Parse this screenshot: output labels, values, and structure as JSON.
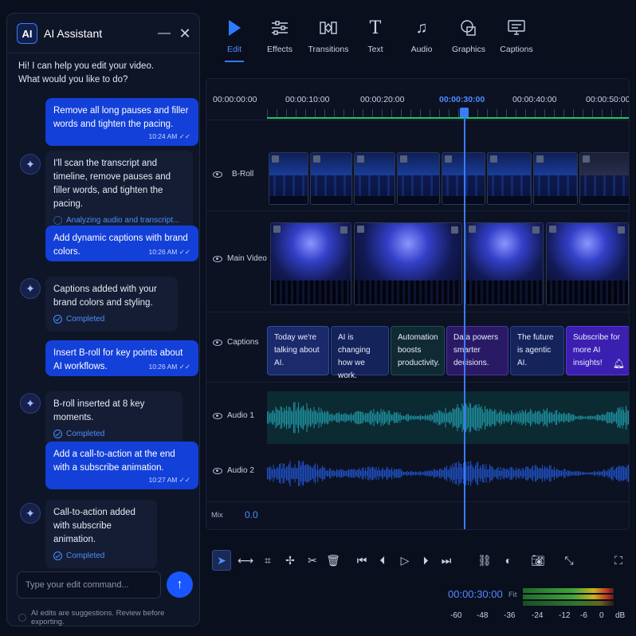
{
  "ai_panel": {
    "logo": "AI",
    "title": "AI Assistant",
    "intro": "Hi! I can help you edit your video.\nWhat would you like to do?",
    "messages": [
      {
        "role": "user",
        "text": "Remove all long pauses and filler words and tighten the pacing.",
        "time": "10:24 AM"
      },
      {
        "role": "ai",
        "text": "I'll scan the transcript and timeline, remove pauses and filler words, and tighten the pacing.",
        "status": "Analyzing audio and transcript..."
      },
      {
        "role": "user",
        "text": "Add dynamic captions with brand colors.",
        "time": "10:26 AM"
      },
      {
        "role": "ai",
        "text": "Captions added with your brand colors and styling.",
        "status": "Completed"
      },
      {
        "role": "user",
        "text": "Insert B-roll for key points about AI workflows.",
        "time": "10:26 AM"
      },
      {
        "role": "ai",
        "text": "B-roll inserted at 8 key moments.",
        "status": "Completed"
      },
      {
        "role": "user",
        "text": "Add a call-to-action at the end with a subscribe animation.",
        "time": "10:27 AM"
      },
      {
        "role": "ai",
        "text": "Call-to-action added with subscribe animation.",
        "status": "Completed"
      }
    ],
    "input_placeholder": "Type your edit command...",
    "footer": "AI edits are suggestions. Review before exporting."
  },
  "toolbar": {
    "tabs": [
      {
        "label": "Edit",
        "icon": "play-icon",
        "active": true
      },
      {
        "label": "Effects",
        "icon": "sliders-icon"
      },
      {
        "label": "Transitions",
        "icon": "transitions-icon"
      },
      {
        "label": "Text",
        "icon": "text-icon"
      },
      {
        "label": "Audio",
        "icon": "music-note-icon"
      },
      {
        "label": "Graphics",
        "icon": "shapes-icon"
      },
      {
        "label": "Captions",
        "icon": "captions-icon"
      }
    ]
  },
  "timeline": {
    "ruler": [
      "00:00:00:00",
      "00:00:10:00",
      "00:00:20:00",
      "00:00:30:00",
      "00:00:40:00",
      "00:00:50:00"
    ],
    "current_index": 3,
    "tracks": {
      "broll": "B-Roll",
      "main_video": "Main Video",
      "captions": "Captions",
      "audio1": "Audio 1",
      "audio2": "Audio 2"
    },
    "captions": [
      {
        "text": "Today we're talking about AI.",
        "color": "#1a2a6a",
        "border": "#2f4aa8"
      },
      {
        "text": "AI is changing how we work.",
        "color": "#14235a",
        "border": "#2a4290"
      },
      {
        "text": "Automation boosts productivity.",
        "color": "#102a33",
        "border": "#1f5060"
      },
      {
        "text": "Data powers smarter decisions.",
        "color": "#2a1a66",
        "border": "#4a36a8"
      },
      {
        "text": "The future is agentic AI.",
        "color": "#14235a",
        "border": "#2a4290"
      },
      {
        "text": "Subscribe for more AI insights!",
        "color": "#3a1fb0",
        "border": "#5b3ee0"
      }
    ],
    "mix_label": "Mix",
    "mix_value": "0.0"
  },
  "transport": {
    "timecode": "00:00:30:00",
    "fit": "Fit",
    "meter_scale": [
      "-60",
      "-48",
      "-36",
      "-24",
      "-12",
      "-6",
      "0",
      "dB"
    ]
  },
  "colors": {
    "accent": "#2f7bff",
    "user_bubble": "#1340d8",
    "ruler_line": "#22c55e"
  }
}
